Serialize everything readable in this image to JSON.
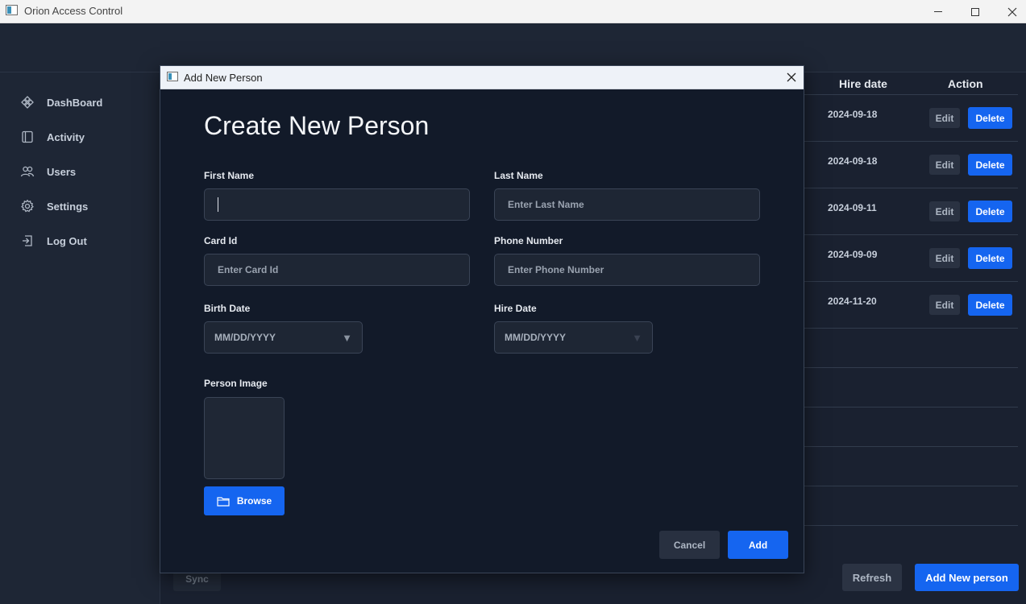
{
  "window": {
    "title": "Orion Access Control"
  },
  "sidebar": {
    "items": [
      {
        "label": "DashBoard",
        "icon": "dashboard-icon"
      },
      {
        "label": "Activity",
        "icon": "activity-icon"
      },
      {
        "label": "Users",
        "icon": "users-icon"
      },
      {
        "label": "Settings",
        "icon": "gear-icon"
      },
      {
        "label": "Log Out",
        "icon": "logout-icon"
      }
    ]
  },
  "table": {
    "columns": {
      "hire_date": "Hire date",
      "action": "Action"
    },
    "rows": [
      {
        "hire_date": "2024-09-18",
        "edit": "Edit",
        "delete": "Delete"
      },
      {
        "hire_date": "2024-09-18",
        "edit": "Edit",
        "delete": "Delete"
      },
      {
        "hire_date": "2024-09-11",
        "edit": "Edit",
        "delete": "Delete"
      },
      {
        "hire_date": "2024-09-09",
        "edit": "Edit",
        "delete": "Delete"
      },
      {
        "hire_date": "2024-11-20",
        "edit": "Edit",
        "delete": "Delete"
      }
    ]
  },
  "footer": {
    "sync": "Sync",
    "refresh": "Refresh",
    "add_new_person": "Add New person"
  },
  "dialog": {
    "title": "Add New Person",
    "heading": "Create New Person",
    "first_name": {
      "label": "First Name",
      "value": ""
    },
    "last_name": {
      "label": "Last Name",
      "placeholder": "Enter Last Name"
    },
    "card_id": {
      "label": "Card Id",
      "placeholder": "Enter Card Id"
    },
    "phone": {
      "label": "Phone Number",
      "placeholder": "Enter Phone Number"
    },
    "birth_date": {
      "label": "Birth Date",
      "placeholder": "MM/DD/YYYY"
    },
    "hire_date": {
      "label": "Hire Date",
      "placeholder": "MM/DD/YYYY"
    },
    "person_image": {
      "label": "Person Image"
    },
    "browse": "Browse",
    "cancel": "Cancel",
    "add": "Add"
  },
  "colors": {
    "accent": "#1565f0",
    "background": "#1a2130",
    "dialog_bg": "#121a29"
  }
}
